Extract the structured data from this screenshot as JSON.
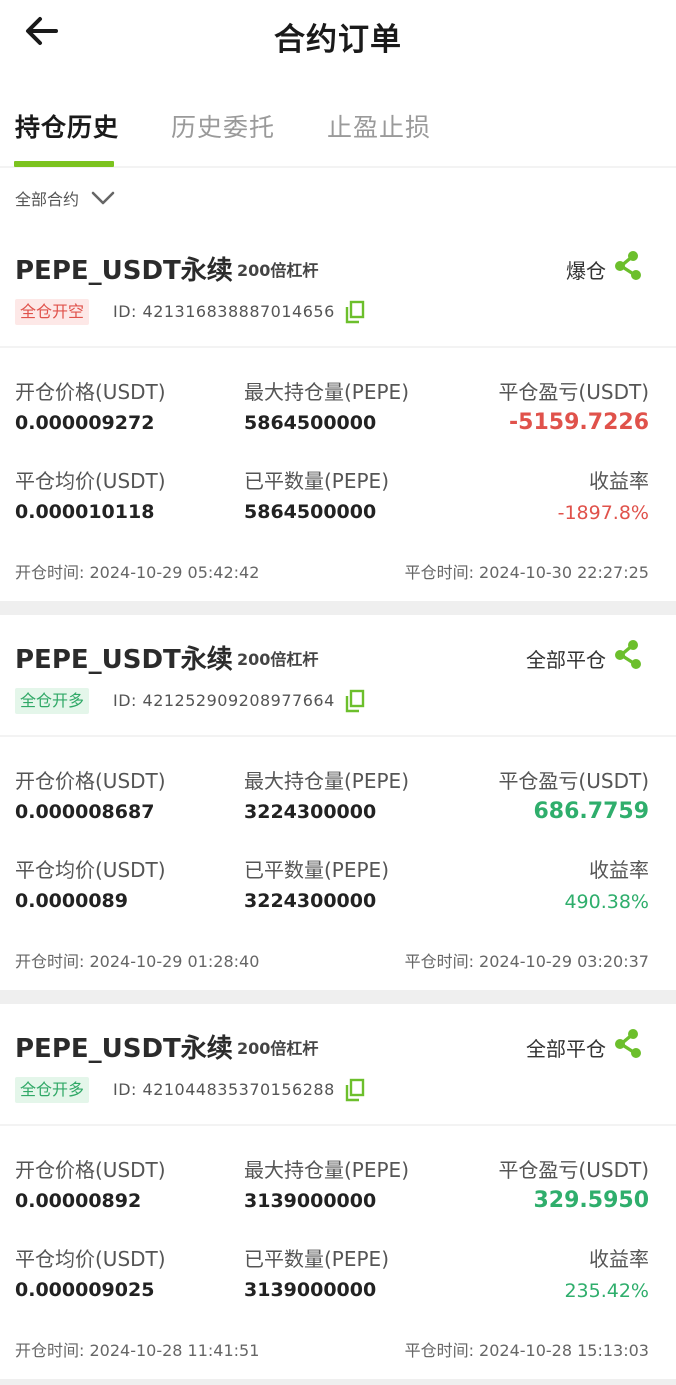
{
  "header": {
    "title": "合约订单"
  },
  "tabs": [
    {
      "label": "持仓历史"
    },
    {
      "label": "历史委托"
    },
    {
      "label": "止盈止损"
    }
  ],
  "filter": {
    "label": "全部合约"
  },
  "field_labels": {
    "open_price": "开仓价格(USDT)",
    "max_position": "最大持仓量(PEPE)",
    "pnl": "平仓盈亏(USDT)",
    "close_avg": "平仓均价(USDT)",
    "closed_qty": "已平数量(PEPE)",
    "roe": "收益率"
  },
  "orders": [
    {
      "pair": "PEPE_USDT永续",
      "leverage": "200倍杠杆",
      "status": "爆仓",
      "side": "全仓开空",
      "id": "ID:  421316838887014656",
      "open_price": "0.000009272",
      "max_position": "5864500000",
      "pnl": "-5159.7226",
      "close_avg": "0.000010118",
      "closed_qty": "5864500000",
      "roe": "-1897.8%",
      "open_time": "开仓时间: 2024-10-29 05:42:42",
      "close_time": "平仓时间: 2024-10-30 22:27:25"
    },
    {
      "pair": "PEPE_USDT永续",
      "leverage": "200倍杠杆",
      "status": "全部平仓",
      "side": "全仓开多",
      "id": "ID:  421252909208977664",
      "open_price": "0.000008687",
      "max_position": "3224300000",
      "pnl": "686.7759",
      "close_avg": "0.0000089",
      "closed_qty": "3224300000",
      "roe": "490.38%",
      "open_time": "开仓时间: 2024-10-29 01:28:40",
      "close_time": "平仓时间: 2024-10-29 03:20:37"
    },
    {
      "pair": "PEPE_USDT永续",
      "leverage": "200倍杠杆",
      "status": "全部平仓",
      "side": "全仓开多",
      "id": "ID:  421044835370156288",
      "open_price": "0.00000892",
      "max_position": "3139000000",
      "pnl": "329.5950",
      "close_avg": "0.000009025",
      "closed_qty": "3139000000",
      "roe": "235.42%",
      "open_time": "开仓时间: 2024-10-28 11:41:51",
      "close_time": "平仓时间: 2024-10-28 15:13:03"
    }
  ],
  "colors": {
    "accent": "#7cc31f",
    "loss": "#e0524b",
    "profit": "#2fae6c",
    "share_icon": "#6cbf2c"
  },
  "icons": {
    "back": "arrow-left-icon",
    "filter": "chevron-down-icon",
    "share": "share-icon",
    "copy": "copy-icon"
  }
}
